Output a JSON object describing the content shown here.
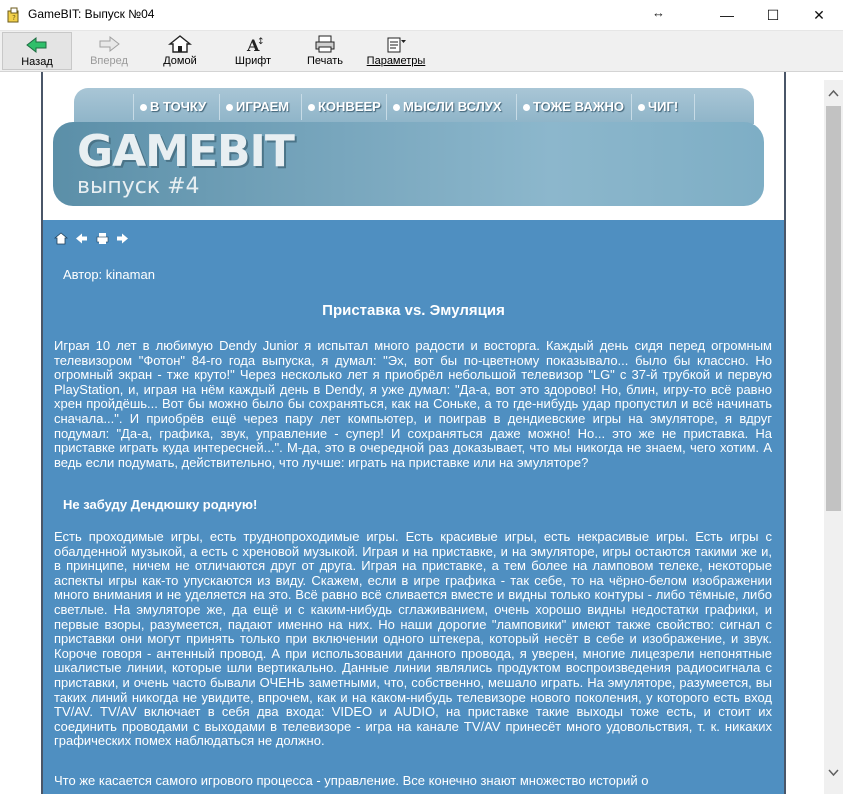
{
  "window": {
    "title": "GameBIT: Выпуск №04",
    "minimize": "—",
    "maximize": "☐",
    "close": "✕",
    "resize_hint": "↔"
  },
  "toolbar": {
    "back": "Назад",
    "forward": "Вперед",
    "home": "Домой",
    "font": "Шрифт",
    "print": "Печать",
    "params": "Параметры"
  },
  "banner": {
    "nav": [
      "В ТОЧКУ",
      "ИГРАЕМ",
      "КОНВЕЕР",
      "МЫСЛИ ВСЛУХ",
      "ТОЖЕ ВАЖНО",
      "ЧИГ!"
    ],
    "logo": "GAMEBIT",
    "issue": "выпуск #4"
  },
  "article": {
    "author": "Автор: kinaman",
    "title": "Приставка vs. Эмуляция",
    "p1": "  Играя 10 лет в любимую Dendy Junior я испытал много радости и восторга. Каждый день сидя перед огромным телевизором \"Фотон\" 84-го года выпуска, я думал: \"Эх, вот бы по-цветному показывало... было бы классно. Но огромный экран - тже круто!\" Через несколько лет я приобрёл небольшой телевизор \"LG\" с 37-й трубкой и первую PlayStation, и, играя на нём каждый день в Dendy, я уже думал: \"Да-а, вот это здорово! Но, блин, игру-то всё равно хрен пройдёшь... Вот бы можно было бы сохраняться, как на Соньке, а то где-нибудь удар пропустил и всё начинать сначала...\". И приобрёв ещё через пару лет компьютер, и поиграв в дендиевские игры на эмуляторе, я вдруг подумал: \"Да-а, графика, звук, управление - супер! И сохраняться даже можно! Но... это же не приставка. На приставке играть куда интересней...\". М-да, это в очередной раз доказывает, что мы никогда не знаем, чего хотим. А ведь если подумать, действительно, что лучше: играть на приставке или на эмуляторе?",
    "subhead": "Не забуду Дендюшку родную!",
    "p2": "  Есть проходимые игры, есть труднопроходимые игры. Есть красивые игры, есть некрасивые игры. Есть игры с обалденной музыкой, а есть с хреновой музыкой. Играя и на приставке, и на эмуляторе, игры остаются такими же и, в принципе, ничем не отличаются друг от друга. Играя на приставке, а тем более на ламповом телеке, некоторые аспекты игры как-то упускаются из виду. Скажем, если в игре графика - так себе, то на чёрно-белом изображении много внимания и не уделяется на это. Всё равно всё сливается вместе и видны только контуры - либо тёмные, либо светлые. На эмуляторе же, да ещё и с каким-нибудь сглаживанием, очень хорошо видны недостатки графики, и первые взоры, разумеется, падают именно на них. Но наши дорогие \"ламповики\" имеют также свойство: сигнал с приставки они могут принять только при включении одного штекера, который несёт в себе и изображение, и звук. Короче говоря - антенный провод. А при использовании данного провода, я уверен, многие лицезрели непонятные шкалистые линии, которые шли вертикально. Данные линии являлись продуктом воспроизведения радиосигнала с приставки, и очень часто бывали ОЧЕНЬ заметными, что, собственно, мешало играть. На эмуляторе, разумеется, вы таких линий никогда не увидите, впрочем, как и на каком-нибудь телевизоре нового поколения, у которого есть вход TV/AV. TV/AV включает в себя два входа: VIDEO и AUDIO, на приставке такие выходы тоже есть, и стоит их соединить проводами с выходами в телевизоре - игра на канале TV/AV принесёт много удовольствия, т. к. никаких графических помех наблюдаться не должно.",
    "p3": "  Что же касается самого игрового процесса - управление. Все конечно знают множество историй о"
  },
  "colors": {
    "content_bg": "#4f8fc1",
    "banner": "#8cb7cc",
    "frame": "#4a5668"
  }
}
